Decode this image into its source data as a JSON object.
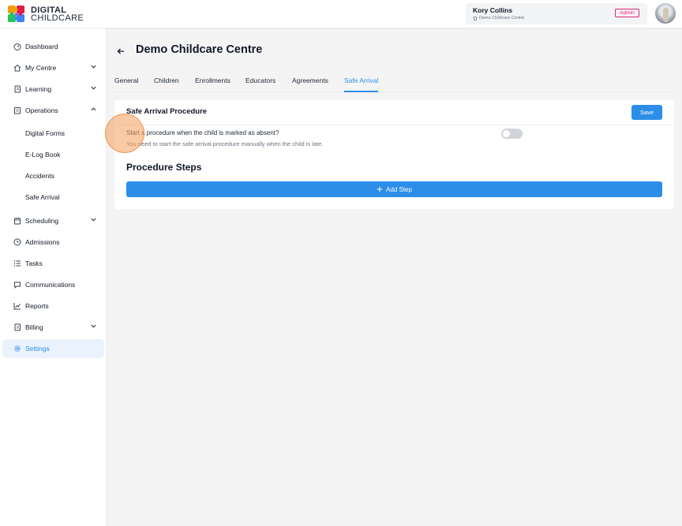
{
  "brand": {
    "line1": "DIGITAL",
    "line2": "CHILDCARE"
  },
  "user": {
    "name": "Kory Collins",
    "centre": "Demo Childcare Centre",
    "role": "Admin"
  },
  "sidebar": {
    "items": [
      {
        "label": "Dashboard",
        "icon": "dashboard-icon"
      },
      {
        "label": "My Centre",
        "icon": "home-icon"
      },
      {
        "label": "Learning",
        "icon": "book-icon"
      },
      {
        "label": "Operations",
        "icon": "clipboard-icon"
      },
      {
        "label": "Digital Forms"
      },
      {
        "label": "E-Log Book"
      },
      {
        "label": "Accidents"
      },
      {
        "label": "Safe Arrival"
      },
      {
        "label": "Scheduling",
        "icon": "calendar-icon"
      },
      {
        "label": "Admissions",
        "icon": "clock-icon"
      },
      {
        "label": "Tasks",
        "icon": "list-icon"
      },
      {
        "label": "Communications",
        "icon": "chat-icon"
      },
      {
        "label": "Reports",
        "icon": "chart-icon"
      },
      {
        "label": "Billing",
        "icon": "receipt-icon"
      },
      {
        "label": "Settings",
        "icon": "gear-icon"
      }
    ],
    "collapse_glyph": "<"
  },
  "page": {
    "title": "Demo Childcare Centre"
  },
  "tabs": [
    "General",
    "Children",
    "Enrollments",
    "Educators",
    "Agreements",
    "Safe Arrival"
  ],
  "active_tab": "Safe Arrival",
  "card": {
    "title": "Safe Arrival Procedure",
    "save_label": "Save",
    "question": "Start a procedure when the child is marked as absent?",
    "hint": "You need to start the safe arrival procedure manually when the child is late.",
    "toggle_on": false,
    "steps_title": "Procedure Steps",
    "add_step_label": "Add Step"
  },
  "colors": {
    "accent": "#2c8ee8",
    "admin": "#db2777",
    "active_bg": "#eaf3fd"
  }
}
